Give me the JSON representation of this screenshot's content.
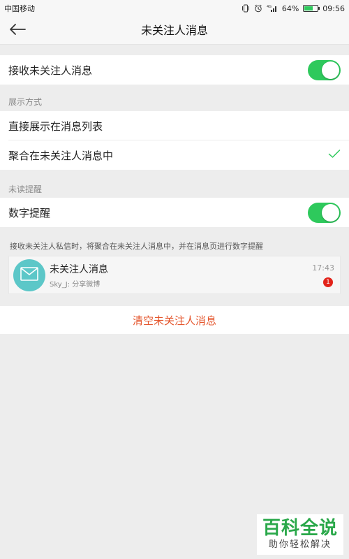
{
  "status_bar": {
    "carrier": "中国移动",
    "battery_percent": "64%",
    "battery_level": 0.64,
    "time": "09:56",
    "icons": [
      "vibrate-icon",
      "alarm-icon",
      "4g-signal-icon",
      "battery-icon"
    ]
  },
  "nav": {
    "title": "未关注人消息",
    "back_icon": "arrow-left-icon"
  },
  "settings": {
    "receive_label": "接收未关注人消息",
    "receive_enabled": true,
    "display_section_header": "展示方式",
    "display_option_list": "直接展示在消息列表",
    "display_option_aggregate": "聚合在未关注人消息中",
    "selected_display_option": "聚合在未关注人消息中",
    "unread_section_header": "未读提醒",
    "number_alert_label": "数字提醒",
    "number_alert_enabled": true
  },
  "hint_text": "接收未关注人私信时，将聚合在未关注人消息中，并在消息页进行数字提醒",
  "preview_message": {
    "title": "未关注人消息",
    "preview": "Sky_J: 分享微博",
    "time": "17:43",
    "badge": "1",
    "icon": "envelope-icon"
  },
  "clear_button_label": "清空未关注人消息",
  "watermark": {
    "title": "百科全说",
    "subtitle": "助你轻松解决"
  },
  "colors": {
    "accent_green": "#2ec95c",
    "danger_red": "#e4552c",
    "avatar_teal": "#5cc7c8",
    "badge_red": "#e2231a"
  }
}
